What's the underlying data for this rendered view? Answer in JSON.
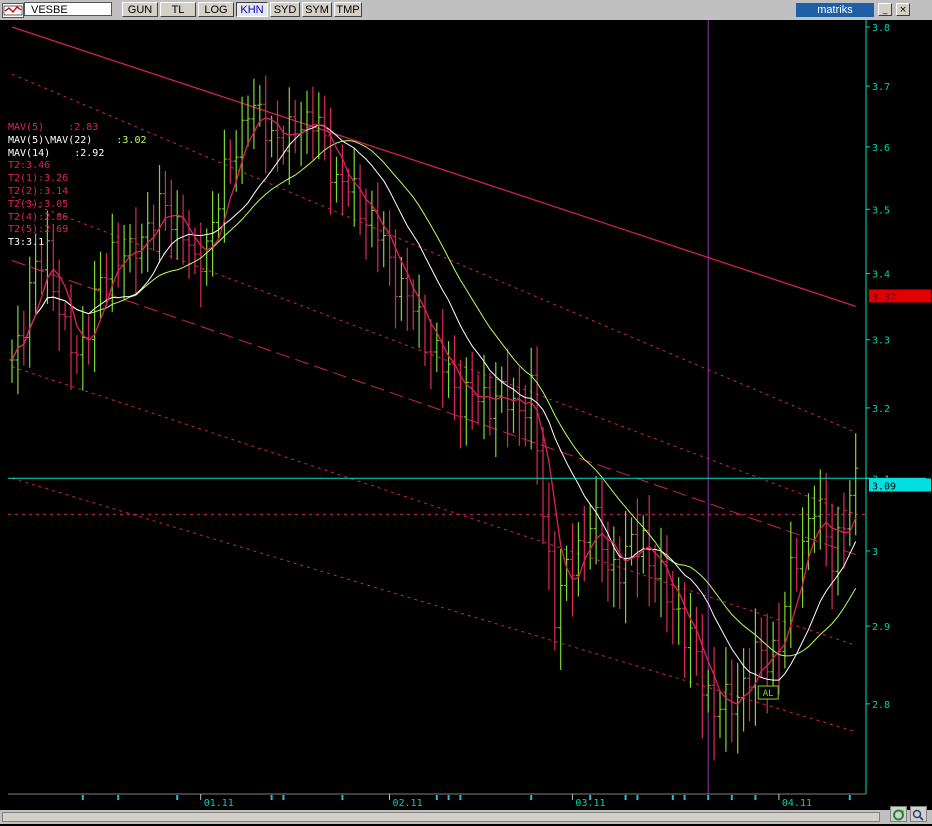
{
  "toolbar": {
    "ticker": "VESBE",
    "buttons": [
      "GUN",
      "TL",
      "LOG",
      "KHN",
      "SYD",
      "SYM",
      "TMP"
    ],
    "active_button": "KHN",
    "brand": "matriks",
    "window_buttons": [
      "_",
      "×"
    ]
  },
  "legend": [
    {
      "label": "MAV(5)",
      "value": ":2.83",
      "color": "#e0205a"
    },
    {
      "label": "MAV(5)\\MAV(22)",
      "value": ":3.02",
      "color": "#ffffff",
      "value_color": "#b8ff60"
    },
    {
      "label": "MAV(14)",
      "value": ":2.92",
      "color": "#ffffff"
    },
    {
      "label": "T2:3.46",
      "value": "",
      "color": "#e0205a"
    },
    {
      "label": "T2(1):3.26",
      "value": "",
      "color": "#e0205a"
    },
    {
      "label": "T2(2):3.14",
      "value": "",
      "color": "#e0205a"
    },
    {
      "label": "T2(3):3.05",
      "value": "",
      "color": "#e0205a"
    },
    {
      "label": "T2(4):2.86",
      "value": "",
      "color": "#e0205a"
    },
    {
      "label": "T2(5):2.69",
      "value": "",
      "color": "#e0205a"
    },
    {
      "label": "T3:3.1",
      "value": "",
      "color": "#ffffff"
    }
  ],
  "signal_label": "AL",
  "price_tags": [
    {
      "text": "3.37",
      "value": 3.365,
      "bg": "#e00000",
      "fg": "#600000"
    },
    {
      "text": "3.09",
      "value": 3.09,
      "bg": "#00e0e0",
      "fg": "#000000"
    }
  ],
  "colors": {
    "up": "#7fd832",
    "down": "#d82a5a",
    "mav5": "#e0205a",
    "mav14": "#ffffff",
    "mav22": "#b8ff60",
    "channel": "#cc2255",
    "level": "#00e0c0",
    "axis_text": "#00d0b0",
    "background": "#000000"
  },
  "chart_data": {
    "type": "ohlc",
    "title": "",
    "y_axis": {
      "ticks": [
        2.8,
        2.9,
        3.0,
        3.1,
        3.2,
        3.3,
        3.4,
        3.5,
        3.6,
        3.7,
        3.8
      ],
      "range": [
        2.73,
        3.8
      ],
      "scale": "log",
      "position": "right"
    },
    "x_axis": {
      "labels": [
        "01.11",
        "02.11",
        "03.11",
        "04.11"
      ],
      "bar_index_range": [
        0,
        143
      ]
    },
    "levels": [
      3.1,
      3.05
    ],
    "vertical_marker_bar": 118,
    "signal_bar": 128,
    "signal_price": 2.815,
    "channels": [
      {
        "name": "T2",
        "start": [
          0,
          3.8
        ],
        "end": [
          143,
          3.35
        ],
        "style": "solid"
      },
      {
        "name": "T2(1)",
        "start": [
          0,
          3.72
        ],
        "end": [
          143,
          3.165
        ],
        "style": "dotted"
      },
      {
        "name": "T2(2)",
        "start": [
          0,
          3.52
        ],
        "end": [
          143,
          3.05
        ],
        "style": "dotted"
      },
      {
        "name": "T2(3)",
        "start": [
          0,
          3.42
        ],
        "end": [
          143,
          2.995
        ],
        "style": "dashed"
      },
      {
        "name": "T2(4)",
        "start": [
          0,
          3.26
        ],
        "end": [
          143,
          2.875
        ],
        "style": "dotted"
      },
      {
        "name": "T2(5)",
        "start": [
          0,
          3.1
        ],
        "end": [
          143,
          2.765
        ],
        "style": "dotted"
      }
    ],
    "ohlc_anchors": [
      [
        0,
        3.27
      ],
      [
        4,
        3.4
      ],
      [
        6,
        3.44
      ],
      [
        9,
        3.3
      ],
      [
        11,
        3.28
      ],
      [
        14,
        3.35
      ],
      [
        17,
        3.44
      ],
      [
        20,
        3.42
      ],
      [
        23,
        3.48
      ],
      [
        26,
        3.5
      ],
      [
        29,
        3.47
      ],
      [
        31,
        3.4
      ],
      [
        34,
        3.48
      ],
      [
        37,
        3.58
      ],
      [
        40,
        3.66
      ],
      [
        43,
        3.64
      ],
      [
        46,
        3.6
      ],
      [
        49,
        3.65
      ],
      [
        52,
        3.63
      ],
      [
        55,
        3.55
      ],
      [
        58,
        3.52
      ],
      [
        61,
        3.48
      ],
      [
        64,
        3.42
      ],
      [
        67,
        3.36
      ],
      [
        70,
        3.31
      ],
      [
        73,
        3.26
      ],
      [
        76,
        3.22
      ],
      [
        79,
        3.21
      ],
      [
        82,
        3.22
      ],
      [
        85,
        3.2
      ],
      [
        88,
        3.22
      ],
      [
        90,
        3.05
      ],
      [
        92,
        2.93
      ],
      [
        95,
        2.98
      ],
      [
        98,
        3.05
      ],
      [
        101,
        2.98
      ],
      [
        104,
        2.99
      ],
      [
        107,
        3.02
      ],
      [
        110,
        2.95
      ],
      [
        113,
        2.92
      ],
      [
        116,
        2.85
      ],
      [
        119,
        2.8
      ],
      [
        121,
        2.79
      ],
      [
        124,
        2.83
      ],
      [
        127,
        2.86
      ],
      [
        130,
        2.88
      ],
      [
        133,
        3.0
      ],
      [
        136,
        3.06
      ],
      [
        139,
        3.0
      ],
      [
        141,
        3.04
      ],
      [
        143,
        3.09
      ]
    ],
    "mav5_last": 2.83,
    "mav14_last": 2.92,
    "mav22_last": 3.02
  }
}
